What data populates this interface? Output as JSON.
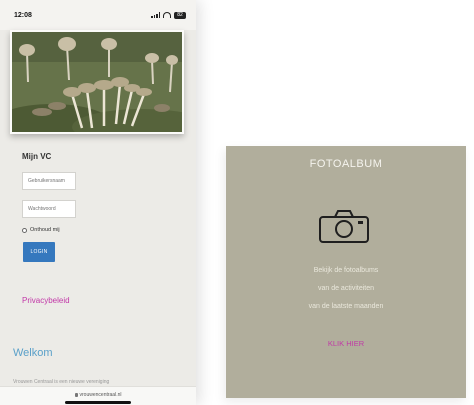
{
  "status_bar": {
    "time": "12:08",
    "battery": "82"
  },
  "hero_image": {
    "subject": "mushrooms in grass"
  },
  "login": {
    "heading": "Mijn VC",
    "username_placeholder": "Gebruikersnaam",
    "password_placeholder": "Wachtwoord",
    "remember_label": "Onthoud mij",
    "login_button": "LOGIN"
  },
  "links": {
    "privacy": "Privacybeleid"
  },
  "welcome": {
    "heading": "Welkom",
    "teaser": "Vrouwen Centraal is een nieuwe vereniging"
  },
  "browser": {
    "url": "vrouwencentraal.nl"
  },
  "fotoalbum": {
    "title": "FOTOALBUM",
    "icon": "camera-icon",
    "description": [
      "Bekijk de fotoalbums",
      "van de activiteiten",
      "van de laatste maanden"
    ],
    "link": "KLIK HIER"
  },
  "colors": {
    "card_background": "#b1ae9c",
    "link_magenta": "#c03aa6",
    "login_blue": "#3578be",
    "welcome_blue": "#5aa0c9"
  }
}
